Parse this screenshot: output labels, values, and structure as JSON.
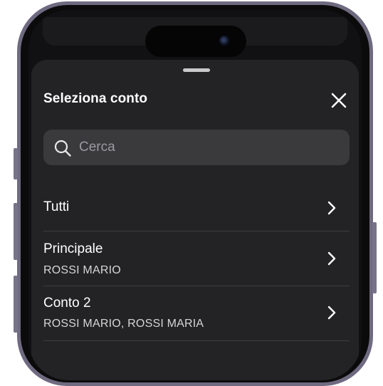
{
  "sheet": {
    "title": "Seleziona conto"
  },
  "search": {
    "placeholder": "Cerca"
  },
  "accounts": [
    {
      "title": "Tutti",
      "subtitle": ""
    },
    {
      "title": "Principale",
      "subtitle": "ROSSI MARIO"
    },
    {
      "title": "Conto 2",
      "subtitle": "ROSSI MARIO, ROSSI MARIA"
    }
  ],
  "icons": {
    "close": "close-icon",
    "search": "search-icon",
    "chevron": "chevron-right-icon"
  },
  "colors": {
    "sheet_background": "#232325",
    "search_background": "#3a3a3d",
    "text_primary": "#ffffff",
    "phone_frame": "#6f6a80"
  }
}
